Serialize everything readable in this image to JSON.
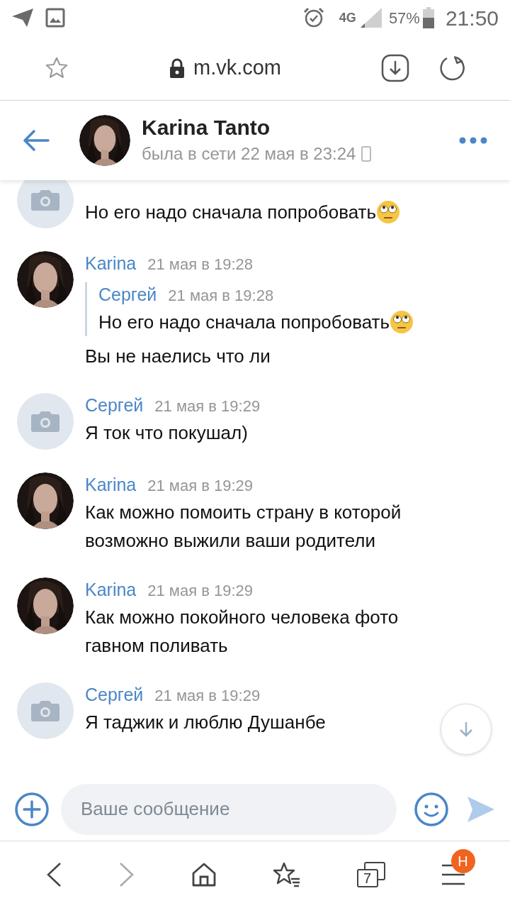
{
  "status_bar": {
    "battery": "57%",
    "time": "21:50",
    "network": "4G"
  },
  "address_bar": {
    "url": "m.vk.com"
  },
  "chat_header": {
    "name": "Karina Tanto",
    "last_seen": "была в сети 22 мая в 23:24"
  },
  "messages": [
    {
      "kind": "continued",
      "avatar": {
        "kind": "placeholder"
      },
      "text": "Но его надо сначала попробовать",
      "emoji": true
    },
    {
      "kind": "message",
      "author": "Karina",
      "time": "21 мая в 19:28",
      "quote": {
        "author": "Сергей",
        "time": "21 мая в 19:28",
        "text": "Но его надо сначала попробовать",
        "emoji": true
      },
      "text": "Вы не наелись что ли",
      "emoji": false
    },
    {
      "kind": "message",
      "avatar": {
        "kind": "placeholder"
      },
      "author": "Сергей",
      "time": "21 мая в 19:29",
      "text": "Я ток что покушал)",
      "emoji": false
    },
    {
      "kind": "message",
      "author": "Karina",
      "time": "21 мая в 19:29",
      "text": "Как можно помоить страну в которой возможно выжили ваши родители",
      "emoji": false
    },
    {
      "kind": "message",
      "author": "Karina",
      "time": "21 мая в 19:29",
      "text": "Как можно покойного человека фото гавном поливать",
      "emoji": false
    },
    {
      "kind": "message",
      "avatar": {
        "kind": "placeholder"
      },
      "author": "Сергей",
      "time": "21 мая в 19:29",
      "text": "Я таджик и люблю Душанбе",
      "emoji": false
    }
  ],
  "composer": {
    "placeholder": "Ваше сообщение"
  },
  "browser_nav": {
    "tabs_count": "7",
    "menu_badge": "Н"
  }
}
